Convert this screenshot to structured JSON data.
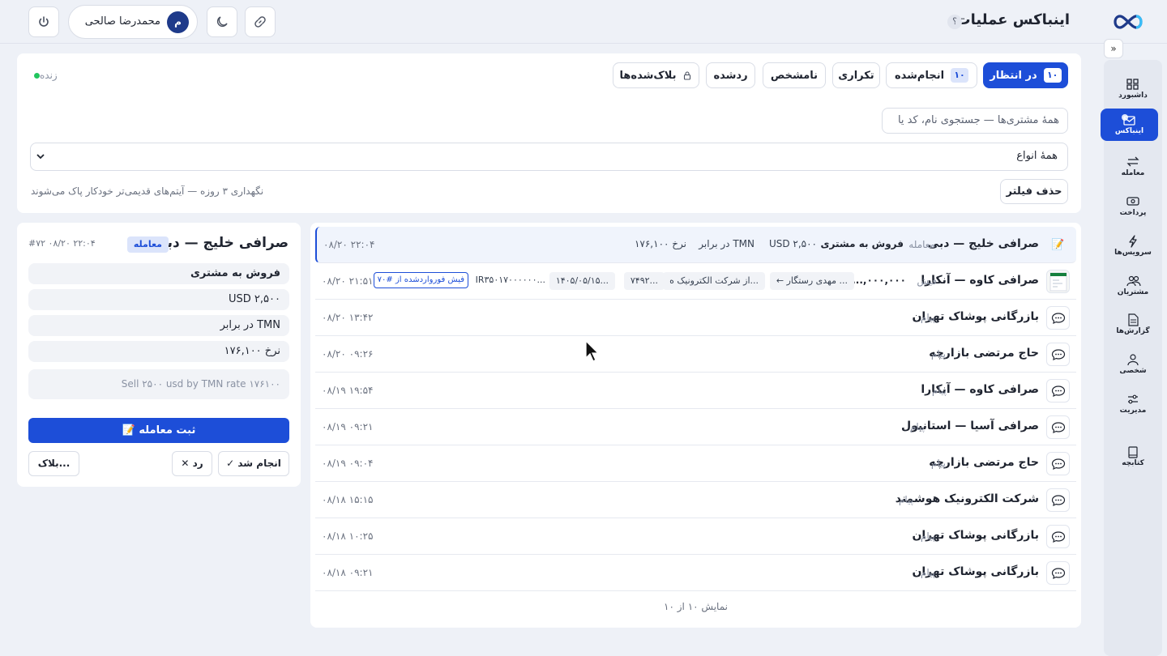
{
  "header": {
    "title": "اینباکس عملیات",
    "help": "؟",
    "user_initial": "م",
    "user_name": "محمدرضا صالحی"
  },
  "sidebar": {
    "collapse": "»",
    "items": [
      {
        "label": "داشبورد",
        "icon": "dashboard-icon"
      },
      {
        "label": "اینباکس",
        "icon": "inbox-icon",
        "active": true
      },
      {
        "label": "معامله",
        "icon": "swap-icon"
      },
      {
        "label": "پرداخت",
        "icon": "payment-icon"
      },
      {
        "label": "سرویس‌ها",
        "icon": "bolt-icon"
      },
      {
        "label": "مشتریان",
        "icon": "customers-icon"
      },
      {
        "label": "گزارش‌ها",
        "icon": "report-icon"
      },
      {
        "label": "شخصی",
        "icon": "person-icon"
      },
      {
        "label": "مدیریت",
        "icon": "sliders-icon"
      },
      {
        "label": "کتابچه",
        "icon": "book-icon"
      }
    ]
  },
  "tabs": {
    "pending": {
      "label": "در انتظار",
      "count": "۱۰"
    },
    "done": {
      "label": "انجام‌شده",
      "count": "۱۰"
    },
    "duplicate": "تکراری",
    "unknown": "نامشخص",
    "rejected": "ردشده",
    "blocked": "بلاک‌شده‌ها"
  },
  "live_label": "زنده",
  "filters": {
    "search_placeholder": "همهٔ مشتری‌ها — جستجوی نام، کد یا",
    "type_select": "همهٔ انواع",
    "clear": "حذف فیلتر",
    "retention": "نگهداری ۳ روزه — آیتم‌های قدیمی‌تر خودکار پاک می‌شوند"
  },
  "list": {
    "rows": [
      {
        "name": "صرافی خلیج — دبی",
        "kind": "معامله",
        "time": "۰۸/۲۰ ۲۲:۰۴",
        "icon": "memo-icon"
      },
      {
        "name": "صرافی کاوه — آنکارا",
        "kind": "فیش",
        "time": "۰۸/۲۰ ۲۱:۵۱",
        "icon": "receipt-thumbnail"
      },
      {
        "name": "بازرگانی پوشاک تهران",
        "kind": "پیام",
        "time": "۰۸/۲۰ ۱۳:۴۲",
        "icon": "chat-icon"
      },
      {
        "name": "حاج مرتضی بازارچه",
        "kind": "پیام",
        "time": "۰۸/۲۰ ۰۹:۲۶",
        "icon": "chat-icon"
      },
      {
        "name": "صرافی کاوه — آنکارا",
        "kind": "پیام",
        "time": "۰۸/۱۹ ۱۹:۵۴",
        "icon": "chat-icon"
      },
      {
        "name": "صرافی آسیا — استانبول",
        "kind": "پیام",
        "time": "۰۸/۱۹ ۰۹:۲۱",
        "icon": "chat-icon"
      },
      {
        "name": "حاج مرتضی بازارچه",
        "kind": "پیام",
        "time": "۰۸/۱۹ ۰۹:۰۴",
        "icon": "chat-icon"
      },
      {
        "name": "شرکت الکترونیک هوشمند",
        "kind": "پیام",
        "time": "۰۸/۱۸ ۱۵:۱۵",
        "icon": "chat-icon"
      },
      {
        "name": "بازرگانی پوشاک تهران",
        "kind": "پیام",
        "time": "۰۸/۱۸ ۱۰:۲۵",
        "icon": "chat-icon"
      },
      {
        "name": "بازرگانی پوشاک تهران",
        "kind": "پیام",
        "time": "۰۸/۱۸ ۰۹:۲۱",
        "icon": "chat-icon"
      }
    ],
    "row0_meta": {
      "action": "فروش به مشتری",
      "amount": "USD ۲,۵۰۰",
      "against": "در برابر TMN",
      "rate": "نرخ ۱۷۶,۱۰۰"
    },
    "row1_meta": {
      "amount": "...,۰۰۰,۰۰۰",
      "to": "← مهدی رستگار ...",
      "from": "از شرکت الکترونیک ه...",
      "ref": "۷۴۹۲...",
      "date": "۱۴۰۵/۰۵/۱۵...",
      "iban": "IR۳۵۰۱۷۰۰۰۰۰۰...",
      "forward": "فیش فورواردشده از #۷۰"
    },
    "footer": "نمایش ۱۰ از ۱۰"
  },
  "detail": {
    "title": "صرافی خلیج — دبی",
    "badge": "معامله",
    "id": "#۷۲ ۰۸/۲۰ ۲۲:۰۴",
    "action": "فروش به مشتری",
    "amount": "USD ۲,۵۰۰",
    "against": "در برابر TMN",
    "rate": "نرخ ۱۷۶,۱۰۰",
    "note": "Sell ۲۵۰۰ usd by TMN rate ۱۷۶۱۰۰",
    "submit": "📝 ثبت معامله",
    "done": "✓ انجام شد",
    "reject": "✕ رد",
    "block": "بلاک..."
  }
}
